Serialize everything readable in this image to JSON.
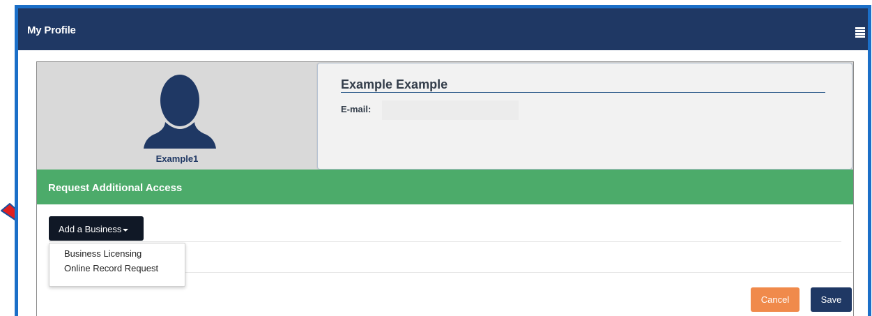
{
  "header": {
    "title": "My Profile",
    "menu_icon": "hamburger-menu-icon"
  },
  "profile": {
    "username": "Example1",
    "full_name": "Example Example",
    "email_label": "E-mail:",
    "email_value": "",
    "avatar_icon": "user-silhouette-icon"
  },
  "access": {
    "section_title": "Request Additional Access",
    "add_button_label": "Add a Business",
    "dropdown_items": [
      "Business Licensing",
      "Online Record Request"
    ]
  },
  "actions": {
    "cancel_label": "Cancel",
    "save_label": "Save"
  },
  "colors": {
    "header_bg": "#1f3864",
    "green_bar": "#4cab6a",
    "cancel": "#f08a4b",
    "save": "#1f3864",
    "arrow": "#e02020"
  }
}
